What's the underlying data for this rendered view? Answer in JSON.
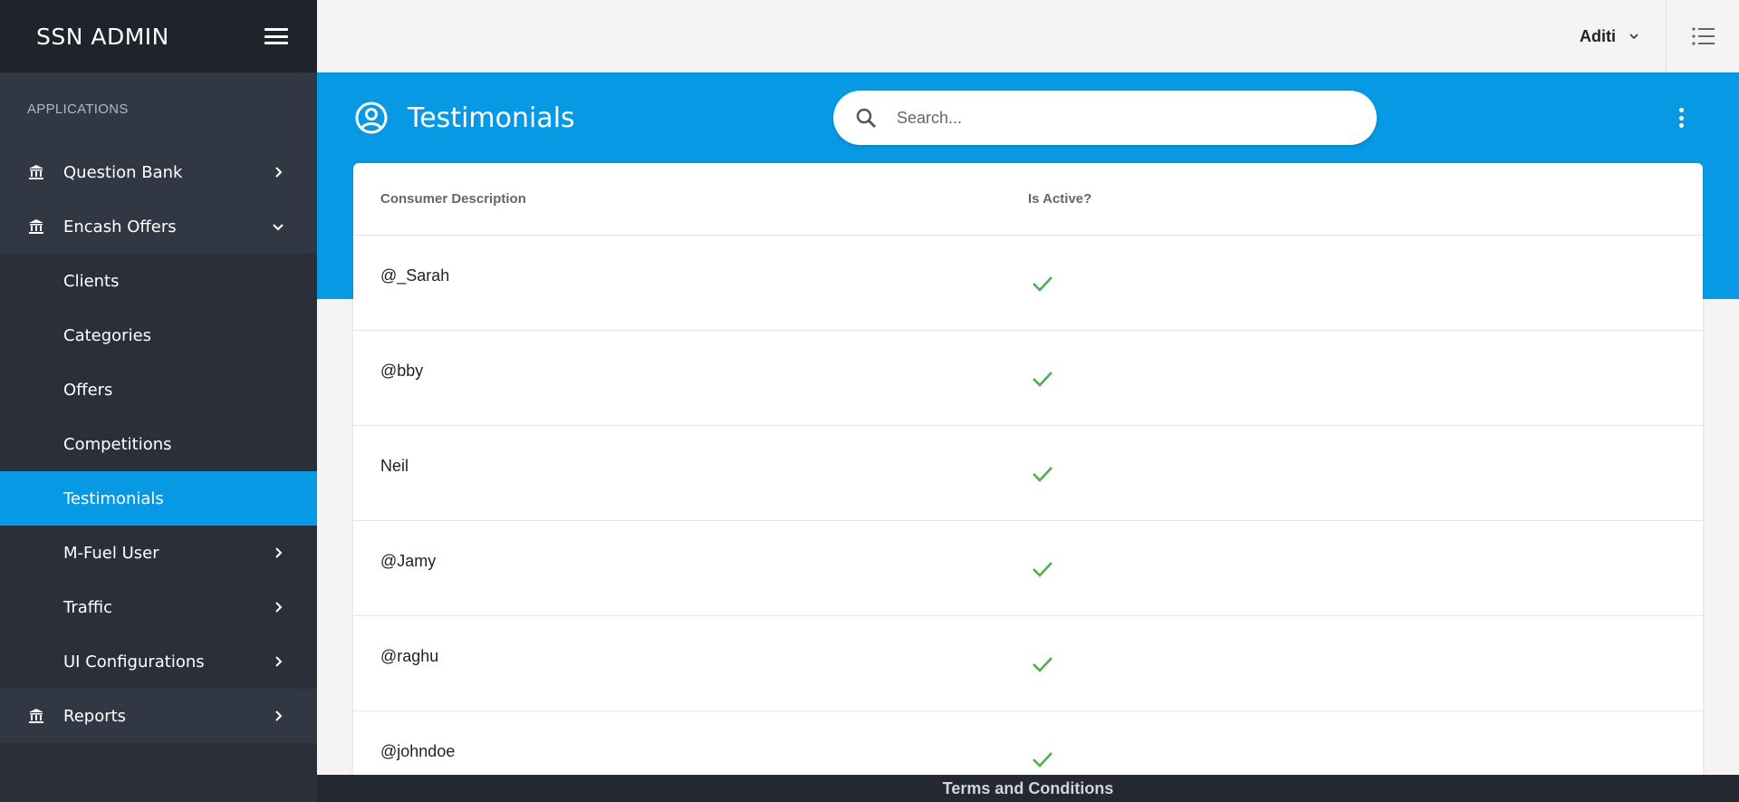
{
  "sidebar": {
    "brand": "SSN ADMIN",
    "section_label": "APPLICATIONS",
    "items": [
      {
        "label": "Question Bank",
        "icon": "bank-icon",
        "chevron": "right"
      },
      {
        "label": "Encash Offers",
        "icon": "bank-icon",
        "chevron": "down"
      },
      {
        "label": "Clients"
      },
      {
        "label": "Categories"
      },
      {
        "label": "Offers"
      },
      {
        "label": "Competitions"
      },
      {
        "label": "Testimonials",
        "active": true
      },
      {
        "label": "M-Fuel User",
        "chevron": "right"
      },
      {
        "label": "Traffic",
        "chevron": "right"
      },
      {
        "label": "UI Configurations",
        "chevron": "right"
      },
      {
        "label": "Reports",
        "icon": "bank-icon",
        "chevron": "right"
      }
    ]
  },
  "topbar": {
    "user_name": "Aditi"
  },
  "header": {
    "title": "Testimonials",
    "search_placeholder": "Search..."
  },
  "table": {
    "columns": [
      "Consumer Description",
      "Is Active?"
    ],
    "rows": [
      {
        "description": "@_Sarah",
        "active": true
      },
      {
        "description": "@bby",
        "active": true
      },
      {
        "description": "Neil",
        "active": true
      },
      {
        "description": "@Jamy",
        "active": true
      },
      {
        "description": "@raghu",
        "active": true
      },
      {
        "description": "@johndoe",
        "active": true
      }
    ]
  },
  "footer": {
    "link": "Terms and Conditions"
  },
  "colors": {
    "accent": "#0899e4",
    "sidebar_bg": "#2a2f3a",
    "check_green": "#4caf50"
  }
}
